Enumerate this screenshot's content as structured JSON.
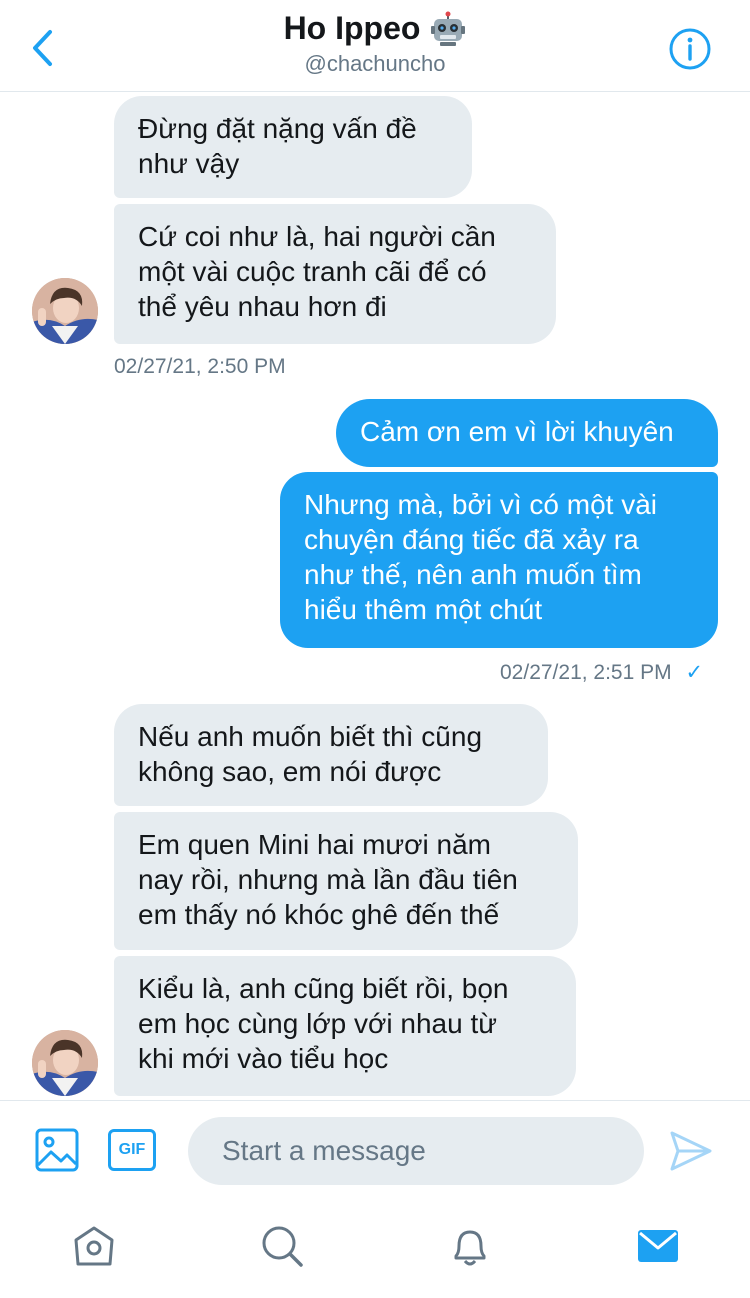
{
  "header": {
    "name": "Ho Ippeo",
    "handle": "@chachuncho"
  },
  "messages": [
    {
      "side": "in",
      "text": "Đừng đặt nặng vấn đề\nnhư vậy"
    },
    {
      "side": "in",
      "text": "Cứ coi như là, hai người cần\nmột vài cuộc tranh cãi để có\nthể yêu nhau hơn đi"
    },
    {
      "side": "out",
      "text": "Cảm ơn em vì lời khuyên"
    },
    {
      "side": "out",
      "text": "Nhưng mà, bởi vì có một vài\nchuyện đáng tiếc đã xảy ra\nnhư thế, nên anh muốn tìm\nhiểu thêm một chút"
    },
    {
      "side": "in",
      "text": "Nếu anh muốn biết thì cũng\nkhông sao, em nói được"
    },
    {
      "side": "in",
      "text": "Em quen Mini hai mươi năm\nnay rồi, nhưng mà lần đầu tiên\nem thấy nó khóc ghê đến thế"
    },
    {
      "side": "in",
      "text": "Kiểu là, anh cũng biết rồi, bọn\nem học cùng lớp với nhau từ\nkhi mới vào tiểu học"
    }
  ],
  "timestamps": {
    "first": "02/27/21, 2:50 PM",
    "second": "02/27/21, 2:51 PM",
    "second_status": "✓"
  },
  "composer": {
    "gif_label": "GIF",
    "placeholder": "Start a message"
  },
  "tabs": [
    "home-icon",
    "search-icon",
    "bell-icon",
    "mail-icon"
  ],
  "colors": {
    "accent": "#1da1f2",
    "incoming_bubble": "#e6ecf0",
    "secondary_text": "#657786"
  }
}
